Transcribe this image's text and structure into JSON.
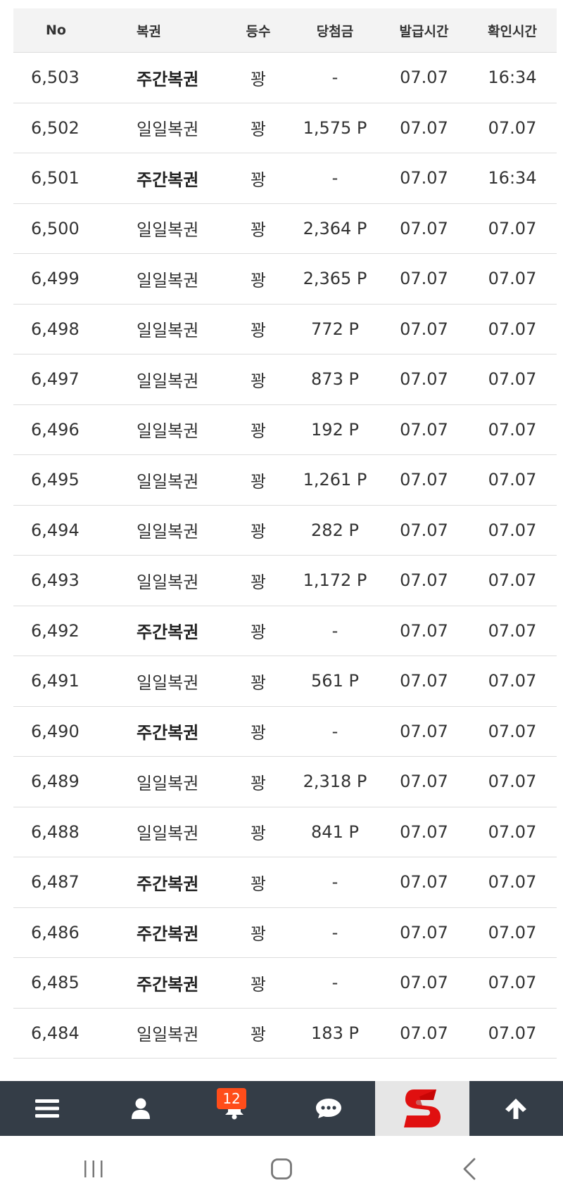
{
  "table": {
    "headers": [
      "No",
      "복권",
      "등수",
      "당첨금",
      "발급시간",
      "확인시간"
    ],
    "rows": [
      {
        "no": "6,503",
        "type": "주간복권",
        "bold": true,
        "rank": "꽝",
        "prize": "-",
        "issued": "07.07",
        "checked": "16:34"
      },
      {
        "no": "6,502",
        "type": "일일복권",
        "bold": false,
        "rank": "꽝",
        "prize": "1,575 P",
        "issued": "07.07",
        "checked": "07.07"
      },
      {
        "no": "6,501",
        "type": "주간복권",
        "bold": true,
        "rank": "꽝",
        "prize": "-",
        "issued": "07.07",
        "checked": "16:34"
      },
      {
        "no": "6,500",
        "type": "일일복권",
        "bold": false,
        "rank": "꽝",
        "prize": "2,364 P",
        "issued": "07.07",
        "checked": "07.07"
      },
      {
        "no": "6,499",
        "type": "일일복권",
        "bold": false,
        "rank": "꽝",
        "prize": "2,365 P",
        "issued": "07.07",
        "checked": "07.07"
      },
      {
        "no": "6,498",
        "type": "일일복권",
        "bold": false,
        "rank": "꽝",
        "prize": "772 P",
        "issued": "07.07",
        "checked": "07.07"
      },
      {
        "no": "6,497",
        "type": "일일복권",
        "bold": false,
        "rank": "꽝",
        "prize": "873 P",
        "issued": "07.07",
        "checked": "07.07"
      },
      {
        "no": "6,496",
        "type": "일일복권",
        "bold": false,
        "rank": "꽝",
        "prize": "192 P",
        "issued": "07.07",
        "checked": "07.07"
      },
      {
        "no": "6,495",
        "type": "일일복권",
        "bold": false,
        "rank": "꽝",
        "prize": "1,261 P",
        "issued": "07.07",
        "checked": "07.07"
      },
      {
        "no": "6,494",
        "type": "일일복권",
        "bold": false,
        "rank": "꽝",
        "prize": "282 P",
        "issued": "07.07",
        "checked": "07.07"
      },
      {
        "no": "6,493",
        "type": "일일복권",
        "bold": false,
        "rank": "꽝",
        "prize": "1,172 P",
        "issued": "07.07",
        "checked": "07.07"
      },
      {
        "no": "6,492",
        "type": "주간복권",
        "bold": true,
        "rank": "꽝",
        "prize": "-",
        "issued": "07.07",
        "checked": "07.07"
      },
      {
        "no": "6,491",
        "type": "일일복권",
        "bold": false,
        "rank": "꽝",
        "prize": "561 P",
        "issued": "07.07",
        "checked": "07.07"
      },
      {
        "no": "6,490",
        "type": "주간복권",
        "bold": true,
        "rank": "꽝",
        "prize": "-",
        "issued": "07.07",
        "checked": "07.07"
      },
      {
        "no": "6,489",
        "type": "일일복권",
        "bold": false,
        "rank": "꽝",
        "prize": "2,318 P",
        "issued": "07.07",
        "checked": "07.07"
      },
      {
        "no": "6,488",
        "type": "일일복권",
        "bold": false,
        "rank": "꽝",
        "prize": "841 P",
        "issued": "07.07",
        "checked": "07.07"
      },
      {
        "no": "6,487",
        "type": "주간복권",
        "bold": true,
        "rank": "꽝",
        "prize": "-",
        "issued": "07.07",
        "checked": "07.07"
      },
      {
        "no": "6,486",
        "type": "주간복권",
        "bold": true,
        "rank": "꽝",
        "prize": "-",
        "issued": "07.07",
        "checked": "07.07"
      },
      {
        "no": "6,485",
        "type": "주간복권",
        "bold": true,
        "rank": "꽝",
        "prize": "-",
        "issued": "07.07",
        "checked": "07.07"
      },
      {
        "no": "6,484",
        "type": "일일복권",
        "bold": false,
        "rank": "꽝",
        "prize": "183 P",
        "issued": "07.07",
        "checked": "07.07"
      }
    ]
  },
  "bottom_nav": {
    "items": [
      {
        "name": "menu",
        "icon": "hamburger-menu-icon"
      },
      {
        "name": "profile",
        "icon": "user-icon"
      },
      {
        "name": "notifications",
        "icon": "bell-icon",
        "badge": "12"
      },
      {
        "name": "chat",
        "icon": "chat-bubble-icon"
      },
      {
        "name": "logo",
        "icon": "site-logo-s-icon"
      },
      {
        "name": "scroll-top",
        "icon": "arrow-up-icon"
      }
    ],
    "badge_color": "#ff4d1a",
    "bar_color": "#343d47"
  },
  "system_nav": {
    "items": [
      {
        "name": "recents",
        "icon": "recents-icon"
      },
      {
        "name": "home",
        "icon": "home-icon"
      },
      {
        "name": "back",
        "icon": "back-icon"
      }
    ]
  }
}
